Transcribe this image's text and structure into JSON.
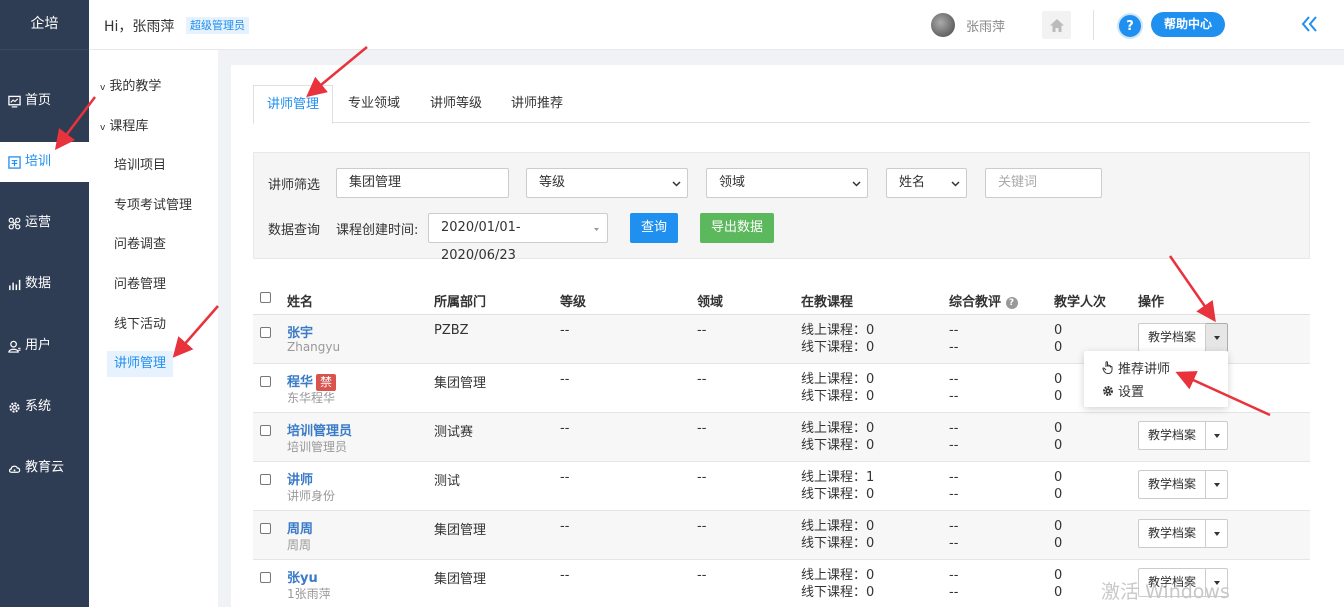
{
  "brand": "企培",
  "nav": [
    {
      "label": "首页",
      "icon": "dashboard-icon"
    },
    {
      "label": "培训",
      "icon": "training-icon"
    },
    {
      "label": "运营",
      "icon": "operations-icon"
    },
    {
      "label": "数据",
      "icon": "chart-icon"
    },
    {
      "label": "用户",
      "icon": "user-icon"
    },
    {
      "label": "系统",
      "icon": "gear-icon"
    },
    {
      "label": "教育云",
      "icon": "cloud-icon"
    }
  ],
  "header": {
    "greeting": "Hi，张雨萍",
    "role": "超级管理员",
    "username": "张雨萍",
    "help_label": "帮助中心"
  },
  "subnav": {
    "groups": [
      "我的教学",
      "课程库"
    ],
    "items": [
      "培训项目",
      "专项考试管理",
      "问卷调查",
      "问卷管理",
      "线下活动",
      "讲师管理"
    ]
  },
  "tabs": [
    "讲师管理",
    "专业领域",
    "讲师等级",
    "讲师推荐"
  ],
  "filter": {
    "label_filter": "讲师筛选",
    "group_value": "集团管理",
    "level_value": "等级",
    "domain_value": "领域",
    "name_value": "姓名",
    "keyword_placeholder": "关键词",
    "label_query": "数据查询",
    "label_created": "课程创建时间:",
    "date_range": "2020/01/01-2020/06/23",
    "query_label": "查询",
    "export_label": "导出数据"
  },
  "table": {
    "headers": [
      "姓名",
      "所属部门",
      "等级",
      "领域",
      "在教课程",
      "综合教评",
      "教学人次",
      "操作"
    ],
    "online_label": "线上课程：",
    "offline_label": "线下课程：",
    "op_label": "教学档案",
    "ban_label": "禁",
    "rows": [
      {
        "name": "张宇",
        "sub": "Zhangyu",
        "dept": "PZBZ",
        "level": "--",
        "domain": "--",
        "online": "0",
        "offline": "0",
        "rating1": "--",
        "rating2": "--",
        "count1": "0",
        "count2": "0",
        "banned": false
      },
      {
        "name": "程华",
        "sub": "东华程华",
        "dept": "集团管理",
        "level": "--",
        "domain": "--",
        "online": "0",
        "offline": "0",
        "rating1": "--",
        "rating2": "--",
        "count1": "0",
        "count2": "0",
        "banned": true
      },
      {
        "name": "培训管理员",
        "sub": "培训管理员",
        "dept": "测试赛",
        "level": "--",
        "domain": "--",
        "online": "0",
        "offline": "0",
        "rating1": "--",
        "rating2": "--",
        "count1": "0",
        "count2": "0",
        "banned": false
      },
      {
        "name": "讲师",
        "sub": "讲师身份",
        "dept": "测试",
        "level": "--",
        "domain": "--",
        "online": "1",
        "offline": "0",
        "rating1": "--",
        "rating2": "--",
        "count1": "0",
        "count2": "0",
        "banned": false
      },
      {
        "name": "周周",
        "sub": "周周",
        "dept": "集团管理",
        "level": "--",
        "domain": "--",
        "online": "0",
        "offline": "0",
        "rating1": "--",
        "rating2": "--",
        "count1": "0",
        "count2": "0",
        "banned": false
      },
      {
        "name": "张yu",
        "sub": "1张雨萍",
        "dept": "集团管理",
        "level": "--",
        "domain": "--",
        "online": "0",
        "offline": "0",
        "rating1": "--",
        "rating2": "--",
        "count1": "0",
        "count2": "0",
        "banned": false
      }
    ]
  },
  "dropdown": {
    "recommend": "推荐讲师",
    "settings": "设置"
  },
  "watermark": "激活 Windows",
  "colors": {
    "nav_bg": "#2f3d54",
    "accent": "#1f8ff0",
    "export_green": "#5cb85c",
    "ban_red": "#d9534f",
    "annotation_arrow": "#e8323c"
  }
}
